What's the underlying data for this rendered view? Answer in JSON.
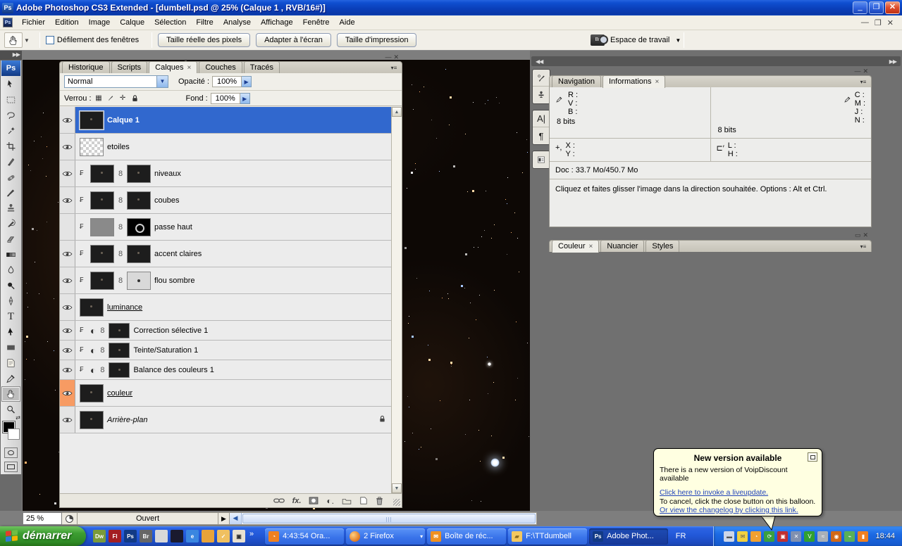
{
  "window": {
    "title": "Adobe Photoshop CS3 Extended - [dumbell.psd @ 25% (Calque 1 , RVB/16#)]",
    "app_badge": "Ps"
  },
  "menu": {
    "items": [
      "Fichier",
      "Edition",
      "Image",
      "Calque",
      "Sélection",
      "Filtre",
      "Analyse",
      "Affichage",
      "Fenêtre",
      "Aide"
    ]
  },
  "options": {
    "scroll_windows_label": "Défilement des fenêtres",
    "buttons": [
      "Taille réelle des pixels",
      "Adapter à l'écran",
      "Taille d'impression"
    ],
    "workspace_label": "Espace de travail"
  },
  "layers_panel": {
    "tabs": [
      "Historique",
      "Scripts",
      "Calques",
      "Couches",
      "Tracés"
    ],
    "active_tab": 2,
    "blend_mode": "Normal",
    "opacity_label": "Opacité :",
    "opacity_value": "100%",
    "lock_label": "Verrou :",
    "fill_label": "Fond :",
    "fill_value": "100%",
    "layers": [
      {
        "name": "Calque 1",
        "selected": true,
        "eye": true,
        "thumb": "dark"
      },
      {
        "name": "etoiles",
        "eye": true,
        "thumb": "checker"
      },
      {
        "name": "niveaux",
        "eye": true,
        "clip": true,
        "thumb": "dark",
        "mask": "dark"
      },
      {
        "name": "coubes",
        "eye": true,
        "clip": true,
        "thumb": "dark",
        "mask": "dark"
      },
      {
        "name": "passe haut",
        "eye": false,
        "clip": true,
        "thumb": "gray",
        "mask": "blackcircle"
      },
      {
        "name": "accent claires",
        "eye": true,
        "clip": true,
        "thumb": "dark",
        "mask": "dark"
      },
      {
        "name": "flou sombre",
        "eye": true,
        "clip": true,
        "thumb": "dark",
        "mask": "light"
      },
      {
        "name": "luminance",
        "eye": true,
        "thumb": "dark",
        "underline": true
      },
      {
        "name": "Correction sélective 1",
        "eye": true,
        "clip": true,
        "adjustment": true,
        "mask": "dark",
        "small": true
      },
      {
        "name": "Teinte/Saturation 1",
        "eye": true,
        "clip": true,
        "adjustment": true,
        "mask": "dark",
        "small": true
      },
      {
        "name": "Balance des couleurs 1",
        "eye": true,
        "clip": true,
        "adjustment": true,
        "mask": "dark",
        "small": true
      },
      {
        "name": "couleur",
        "eye": true,
        "eye_highlight": true,
        "thumb": "dark",
        "underline": true
      },
      {
        "name": "Arrière-plan",
        "eye": true,
        "thumb": "dark",
        "italic": true,
        "locked": true
      }
    ]
  },
  "info_panel": {
    "tabs": [
      "Navigation",
      "Informations"
    ],
    "active_tab": 1,
    "rgb_labels": [
      "R :",
      "V :",
      "B :"
    ],
    "cmyk_labels": [
      "C :",
      "M :",
      "J :",
      "N :"
    ],
    "bits_left": "8 bits",
    "bits_right": "8 bits",
    "xy_labels": [
      "X :",
      "Y :"
    ],
    "lh_labels": [
      "L :",
      "H :"
    ],
    "doc": "Doc : 33.7 Mo/450.7 Mo",
    "tip": "Cliquez et faites glisser l'image dans la direction souhaitée. Options : Alt et Ctrl."
  },
  "color_panel": {
    "tabs": [
      "Couleur",
      "Nuancier",
      "Styles"
    ],
    "active_tab": 0
  },
  "status_bar": {
    "zoom": "25 %",
    "status": "Ouvert"
  },
  "balloon": {
    "title": "New version available",
    "line1": "There is a new version of VoipDiscount available",
    "link1": "Click here to invoke a liveupdate.",
    "line2": "To cancel, click the close button on this balloon.",
    "link2": "Or view the changelog by clicking this link."
  },
  "taskbar": {
    "start_label": "démarrer",
    "overflow_chevron": "»",
    "quick_launch": [
      "dreamweaver-icon",
      "flash-icon",
      "photoshop-icon",
      "bridge-icon",
      "explorer-window-icon",
      "terminal-icon",
      "internet-explorer-icon",
      "media-player-icon",
      "organizer-icon",
      "image-viewer-icon"
    ],
    "tasks": [
      {
        "label": "4:43:54 Ora...",
        "icon": "timer"
      },
      {
        "label": "2 Firefox",
        "icon": "firefox",
        "group": true
      },
      {
        "label": "Boîte de réc...",
        "icon": "mail"
      },
      {
        "label": "F:\\TTdumbell",
        "icon": "folder"
      },
      {
        "label": "Adobe Phot...",
        "icon": "ps",
        "active": true
      },
      {
        "label": "FR",
        "icon": null,
        "lang": true
      }
    ],
    "tray_icons": [
      "network-monitor-icon",
      "mail-tray-icon",
      "clock-tray-icon",
      "update-shield-icon",
      "dual-display-icon",
      "network-error-icon",
      "voipdiscount-icon",
      "modem-icon",
      "volume-icon",
      "usb-device-icon",
      "battery-icon"
    ],
    "clock": "18:44"
  },
  "toolbox": {
    "tools": [
      "move",
      "marquee",
      "lasso",
      "magic-wand",
      "crop",
      "slice",
      "healing-brush",
      "brush",
      "clone-stamp",
      "history-brush",
      "eraser",
      "gradient",
      "blur",
      "dodge",
      "pen",
      "type",
      "path-selection",
      "shape",
      "notes",
      "eyedropper",
      "hand",
      "zoom"
    ],
    "selected": "hand"
  }
}
